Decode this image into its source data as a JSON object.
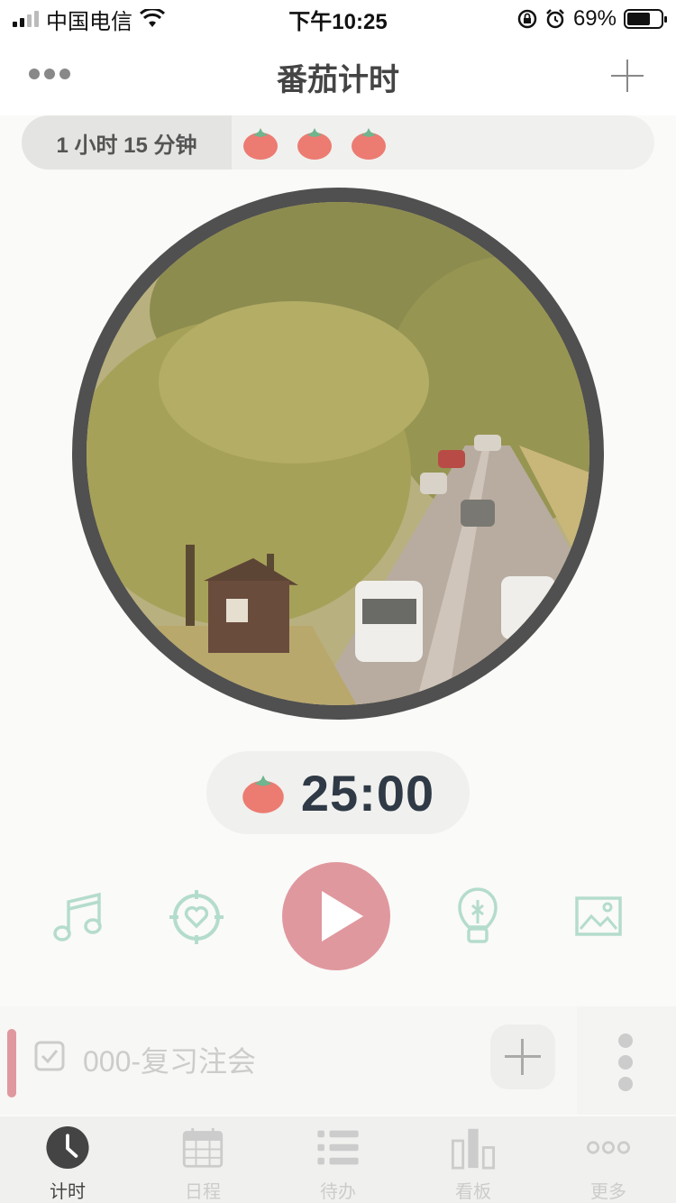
{
  "status_bar": {
    "carrier": "中国电信",
    "time": "下午10:25",
    "battery": "69%",
    "battery_level": 0.69
  },
  "header": {
    "title": "番茄计时"
  },
  "summary": {
    "total_time": "1 小时  15 分钟",
    "tomato_count": 3
  },
  "timer": {
    "value": "25:00"
  },
  "controls": {
    "music_icon": "music-note-icon",
    "focus_icon": "target-heart-icon",
    "play_icon": "play-icon",
    "idea_icon": "lightbulb-icon",
    "image_icon": "image-icon"
  },
  "task": {
    "label": "000-复习注会"
  },
  "tabs": [
    {
      "label": "计时",
      "icon": "clock-icon",
      "active": true
    },
    {
      "label": "日程",
      "icon": "calendar-icon",
      "active": false
    },
    {
      "label": "待办",
      "icon": "list-icon",
      "active": false
    },
    {
      "label": "看板",
      "icon": "bar-chart-icon",
      "active": false
    },
    {
      "label": "更多",
      "icon": "more-icon",
      "active": false
    }
  ],
  "colors": {
    "accent": "#e0989f",
    "tomato": "#ec7b72",
    "icon_teal": "#b4dccd",
    "timer_text": "#2f3a46"
  }
}
